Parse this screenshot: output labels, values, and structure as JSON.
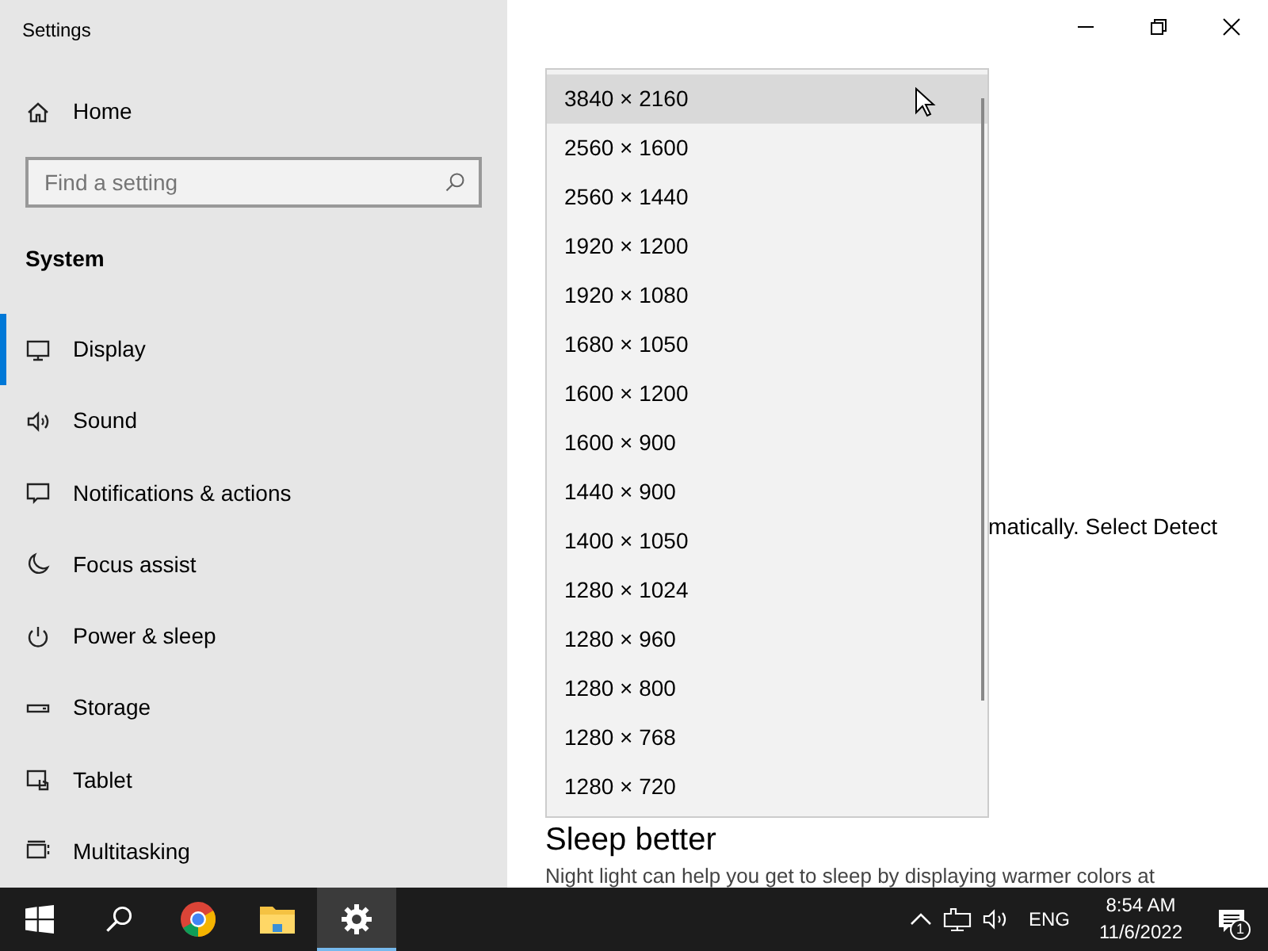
{
  "window": {
    "title": "Settings"
  },
  "sidebar": {
    "home": "Home",
    "search": {
      "placeholder": "Find a setting"
    },
    "section": "System",
    "items": [
      {
        "label": "Display",
        "selected": true
      },
      {
        "label": "Sound",
        "selected": false
      },
      {
        "label": "Notifications & actions",
        "selected": false
      },
      {
        "label": "Focus assist",
        "selected": false
      },
      {
        "label": "Power & sleep",
        "selected": false
      },
      {
        "label": "Storage",
        "selected": false
      },
      {
        "label": "Tablet",
        "selected": false
      },
      {
        "label": "Multitasking",
        "selected": false
      }
    ]
  },
  "content": {
    "partial_text": "matically. Select Detect",
    "heading": "Sleep better",
    "body": "Night light can help you get to sleep by displaying warmer colors at"
  },
  "dropdown": {
    "options": [
      {
        "label": "3840 × 2160",
        "selected": true
      },
      {
        "label": "2560 × 1600",
        "selected": false
      },
      {
        "label": "2560 × 1440",
        "selected": false
      },
      {
        "label": "1920 × 1200",
        "selected": false
      },
      {
        "label": "1920 × 1080",
        "selected": false
      },
      {
        "label": "1680 × 1050",
        "selected": false
      },
      {
        "label": "1600 × 1200",
        "selected": false
      },
      {
        "label": "1600 × 900",
        "selected": false
      },
      {
        "label": "1440 × 900",
        "selected": false
      },
      {
        "label": "1400 × 1050",
        "selected": false
      },
      {
        "label": "1280 × 1024",
        "selected": false
      },
      {
        "label": "1280 × 960",
        "selected": false
      },
      {
        "label": "1280 × 800",
        "selected": false
      },
      {
        "label": "1280 × 768",
        "selected": false
      },
      {
        "label": "1280 × 720",
        "selected": false
      }
    ]
  },
  "taskbar": {
    "apps": [
      {
        "kind": "start",
        "active": false
      },
      {
        "kind": "search",
        "active": false
      },
      {
        "kind": "chrome",
        "active": false
      },
      {
        "kind": "explorer",
        "active": false
      },
      {
        "kind": "settings",
        "active": true
      }
    ],
    "language": "ENG",
    "time": "8:54 AM",
    "date": "11/6/2022",
    "notification_count": "1"
  }
}
